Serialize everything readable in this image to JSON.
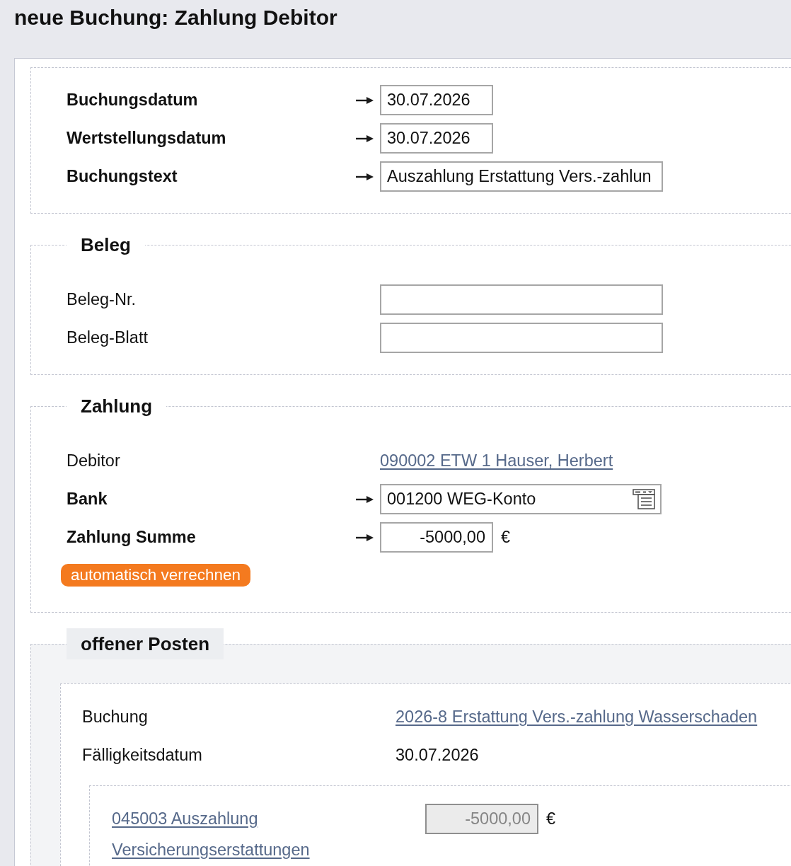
{
  "page": {
    "title": "neue Buchung: Zahlung Debitor"
  },
  "sections": [
    {
      "kind": "plain",
      "rows": [
        {
          "kind": "date",
          "label": "Buchungsdatum",
          "required": true,
          "value": "30.07.2026"
        },
        {
          "kind": "date",
          "label": "Wertstellungsdatum",
          "required": true,
          "value": "30.07.2026"
        },
        {
          "kind": "text",
          "label": "Buchungstext",
          "required": true,
          "value": "Auszahlung Erstattung Vers.-zahlun"
        }
      ]
    },
    {
      "kind": "plain",
      "title": "Beleg",
      "rows": [
        {
          "kind": "text",
          "label": "Beleg-Nr.",
          "required": false
        },
        {
          "kind": "text",
          "label": "Beleg-Blatt",
          "required": false
        }
      ]
    },
    {
      "kind": "plain",
      "title": "Zahlung",
      "rows": [
        {
          "kind": "link",
          "label": "Debitor",
          "required": false,
          "value": "090002 ETW 1 Hauser, Herbert"
        },
        {
          "kind": "select",
          "label": "Bank",
          "required": true,
          "value": "001200 WEG-Konto"
        },
        {
          "kind": "amount",
          "label": "Zahlung Summe",
          "required": true,
          "value": "-5000,00",
          "unit": "€",
          "disabled": false
        }
      ],
      "button": {
        "label": "automatisch verrechnen"
      }
    },
    {
      "kind": "shaded",
      "title": "offener Posten",
      "items": [
        {
          "rows": [
            {
              "kind": "link",
              "label": "Buchung",
              "required": false,
              "value": "2026-8 Erstattung Vers.-zahlung Wasserschaden"
            },
            {
              "kind": "value",
              "label": "Fälligkeitsdatum",
              "required": false,
              "value": "30.07.2026"
            }
          ],
          "allocations": [
            {
              "account": "045003 Auszahlung Versicherungserstattungen",
              "value": "-5000,00",
              "unit": "€",
              "disabled": true
            }
          ]
        }
      ]
    }
  ]
}
